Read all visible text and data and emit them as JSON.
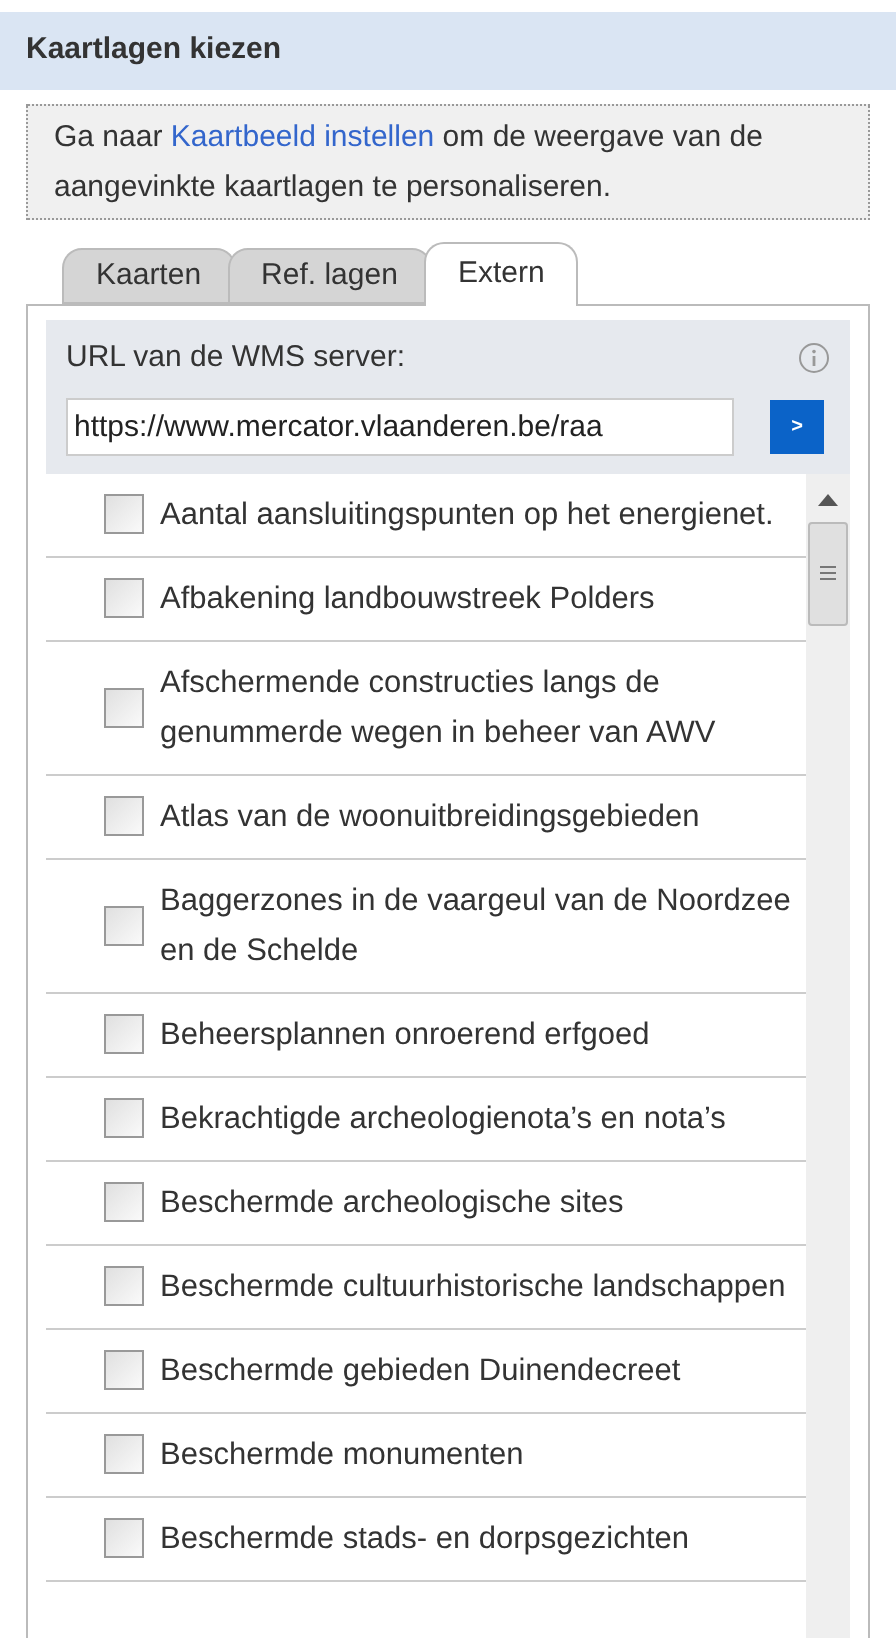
{
  "header": {
    "title": "Kaartlagen kiezen"
  },
  "info": {
    "before": "Ga naar ",
    "link": "Kaartbeeld instellen",
    "after": " om de weergave van de aangevinkte kaartlagen te personaliseren."
  },
  "tabs": [
    {
      "label": "Kaarten",
      "selected": false
    },
    {
      "label": "Ref. lagen",
      "selected": false
    },
    {
      "label": "Extern",
      "selected": true
    }
  ],
  "url_section": {
    "label": "URL van de WMS server:",
    "value": "https://www.mercator.vlaanderen.be/raa",
    "button": ">"
  },
  "layers": [
    {
      "label": "Aantal aansluitingspunten op het energienet.",
      "checked": false
    },
    {
      "label": "Afbakening landbouwstreek Polders",
      "checked": false
    },
    {
      "label": "Afschermende constructies langs de genummerde wegen in beheer van AWV",
      "checked": false
    },
    {
      "label": "Atlas van de woonuitbreidingsgebieden",
      "checked": false
    },
    {
      "label": "Baggerzones in de vaargeul van de Noordzee en de Schelde",
      "checked": false
    },
    {
      "label": "Beheersplannen onroerend erfgoed",
      "checked": false
    },
    {
      "label": "Bekrachtigde archeologienota’s en nota’s",
      "checked": false
    },
    {
      "label": "Beschermde archeologische sites",
      "checked": false
    },
    {
      "label": "Beschermde cultuurhistorische landschappen",
      "checked": false
    },
    {
      "label": "Beschermde gebieden Duinendecreet",
      "checked": false
    },
    {
      "label": "Beschermde monumenten",
      "checked": false
    },
    {
      "label": "Beschermde stads- en dorpsgezichten",
      "checked": false
    }
  ]
}
